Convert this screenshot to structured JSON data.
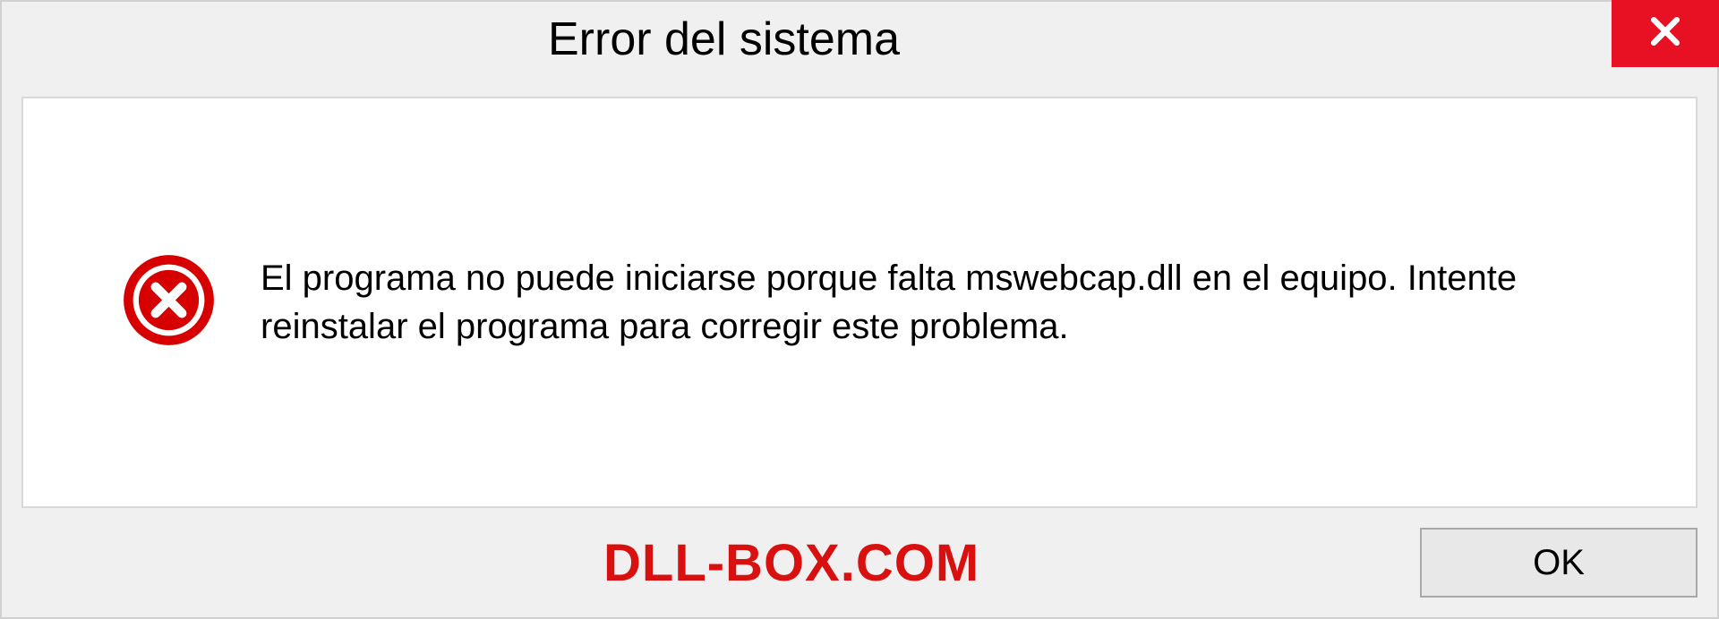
{
  "dialog": {
    "title": "Error del sistema",
    "message": "El programa no puede iniciarse porque falta mswebcap.dll en el equipo. Intente reinstalar el programa para corregir este problema.",
    "ok_label": "OK"
  },
  "watermark": "DLL-BOX.COM"
}
